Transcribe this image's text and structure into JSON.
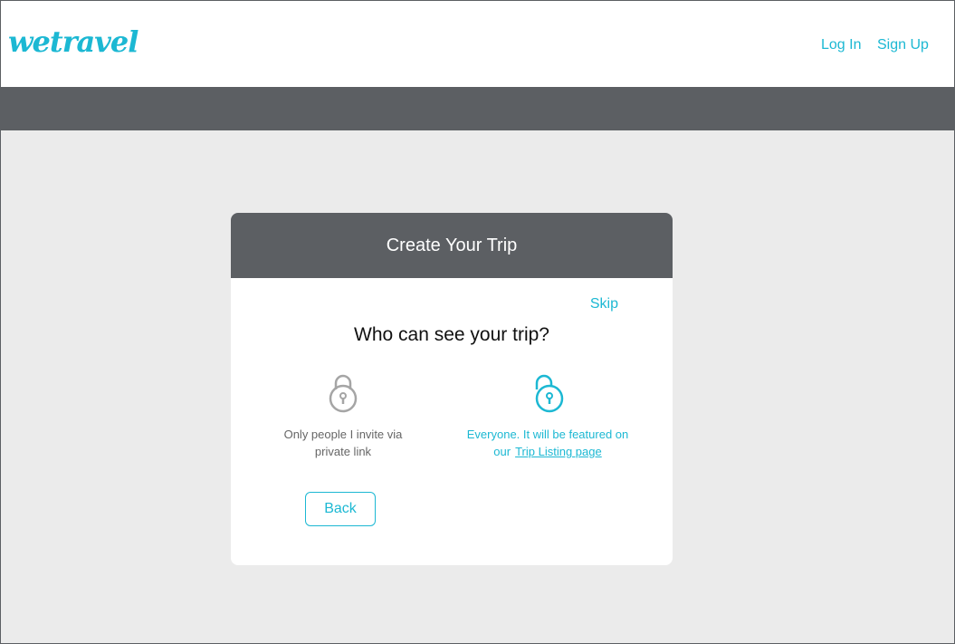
{
  "brand": {
    "logo_text": "wetravel"
  },
  "nav": {
    "login": "Log In",
    "signup": "Sign Up"
  },
  "card": {
    "title": "Create Your Trip",
    "skip": "Skip",
    "question": "Who can see your trip?",
    "private_option": {
      "icon": "lock-closed-icon",
      "line1": "Only people I invite via",
      "line2": "private link"
    },
    "public_option": {
      "icon": "lock-open-icon",
      "line1": "Everyone. It will be featured on",
      "line2_prefix": "our",
      "link_text": "Trip Listing page"
    },
    "back_button": "Back"
  },
  "colors": {
    "accent": "#1cb8d3",
    "dark": "#5c5f63",
    "background": "#ebebeb"
  }
}
